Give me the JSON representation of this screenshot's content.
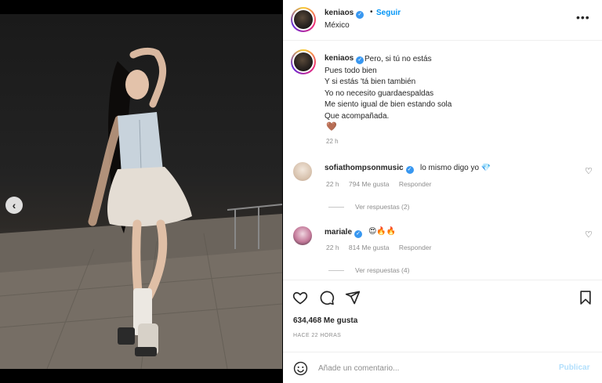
{
  "post": {
    "username": "keniaos",
    "verified_icon": "verified-badge-icon",
    "follow_label": "Seguir",
    "separator": "•",
    "location": "México",
    "more_icon": "more-horizontal-icon",
    "caption_first": "Pero, si tú no estás",
    "caption_lines": [
      "Pues todo bien",
      "Y si estás 'tá bien también",
      "Yo no necesito guardaespaldas",
      "Me siento igual de bien estando sola",
      "Que acompañada."
    ],
    "caption_emoji": "🤎",
    "caption_time": "22 h"
  },
  "comments": [
    {
      "username": "sofiathompsonmusic",
      "text": "lo mismo digo yo 💎",
      "time": "22 h",
      "likes": "794 Me gusta",
      "reply_label": "Responder",
      "view_replies": "Ver respuestas (2)"
    },
    {
      "username": "mariale",
      "text": "😍🔥🔥",
      "time": "22 h",
      "likes": "814 Me gusta",
      "reply_label": "Responder",
      "view_replies": "Ver respuestas (4)"
    }
  ],
  "actions": {
    "like_icon": "heart-icon",
    "comment_icon": "comment-icon",
    "share_icon": "share-icon",
    "save_icon": "bookmark-icon",
    "likes_count": "634,468 Me gusta",
    "posted_ago": "HACE 22 HORAS"
  },
  "comment_box": {
    "emoji_icon": "emoji-icon",
    "placeholder": "Añade un comentario...",
    "publish_label": "Publicar"
  },
  "media": {
    "prev_icon": "chevron-left-icon",
    "prev_glyph": "‹"
  },
  "colors": {
    "accent_blue": "#0095f6",
    "verified_blue": "#3897f0",
    "publish_disabled": "#b2dffc"
  }
}
